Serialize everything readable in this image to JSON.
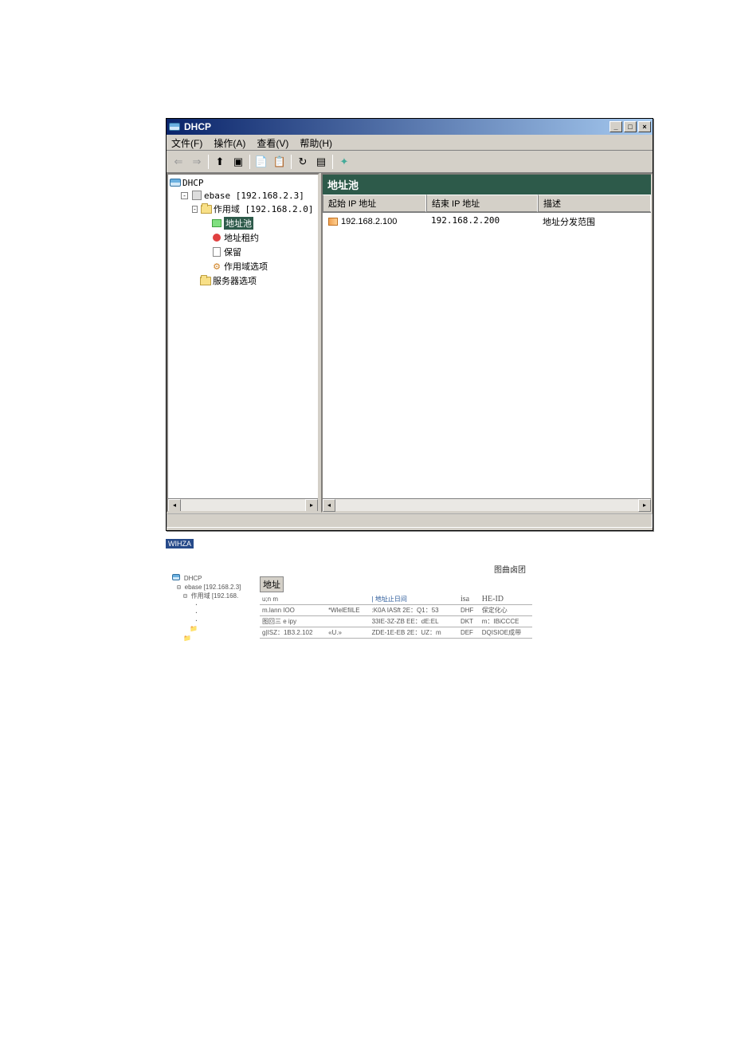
{
  "window": {
    "title": "DHCP"
  },
  "menu": {
    "file": "文件(F)",
    "action": "操作(A)",
    "view": "查看(V)",
    "help": "帮助(H)"
  },
  "tree": {
    "root": "DHCP",
    "server": "ebase [192.168.2.3]",
    "scope": "作用域 [192.168.2.0] r:",
    "pool": "地址池",
    "lease": "地址租约",
    "reservation": "保留",
    "scopeopts": "作用域选项",
    "serveropts": "服务器选项"
  },
  "panel": {
    "title": "地址池",
    "cols": {
      "start": "起始 IP 地址",
      "end": "结束 IP 地址",
      "desc": "描述"
    },
    "row": {
      "start": "192.168.2.100",
      "end": "192.168.2.200",
      "desc": "地址分发范围"
    }
  },
  "watermark": "WIHZA",
  "mini": {
    "topright": "图曲卤团",
    "tree": {
      "root": "DHCP",
      "server": "ebase [192.168.2.3]",
      "scope": "作用域 [192.168."
    },
    "title": "地址",
    "headers": {
      "h1": "u;n m",
      "h2": "地址止日间",
      "h3": "isa",
      "h4": "HE-ID"
    },
    "rows": [
      {
        "c1": "m.lann IOO",
        "c2": "*WlelEfilLE",
        "c3": ":K0A IASft 2E：Q1：53",
        "c4": "DHF",
        "c5": "保定化心"
      },
      {
        "c1": "图回三 e ipy",
        "c2": "",
        "c3": "33IE-3Z-ZB EE：dE:EL",
        "c4": "DKT",
        "c5": "m：IBiCCCE"
      },
      {
        "c1": "g|ISZ：1B3.2.102",
        "c2": "«U.»",
        "c3": "ZDE-1E-EB 2E：UZ：m",
        "c4": "DEF",
        "c5": "DQISIOE成带"
      }
    ]
  }
}
